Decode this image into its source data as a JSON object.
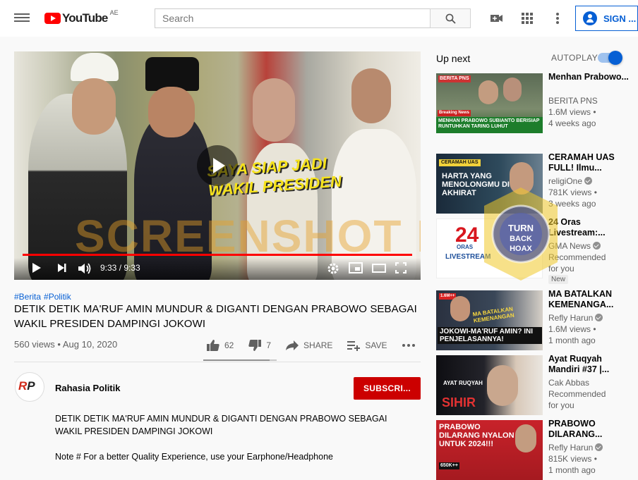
{
  "header": {
    "logo_text": "YouTube",
    "country_code": "AE",
    "search_placeholder": "Search",
    "signin_label": "SIGN ..."
  },
  "player": {
    "overlay_caption_line1": "SAYA SIAP JADI",
    "overlay_caption_line2": "WAKIL PRESIDEN",
    "watermark": "SCREENSHOT BY",
    "current_time": "9:33",
    "duration": "9:33",
    "time_display": "9:33 / 9:33",
    "progress_fraction": 1.0
  },
  "video": {
    "tags": [
      "#Berita",
      "#Politik"
    ],
    "title": "DETIK DETIK MA'RUF AMIN MUNDUR & DIGANTI DENGAN PRABOWO SEBAGAI WAKIL PRESIDEN DAMPINGI JOKOWI",
    "views_date": "560 views • Aug 10, 2020",
    "likes": "62",
    "dislikes": "7",
    "share_label": "SHARE",
    "save_label": "SAVE",
    "like_ratio": 0.9
  },
  "channel": {
    "avatar_text": "RP",
    "name": "Rahasia Politik",
    "subscribe_label": "SUBSCRI..."
  },
  "description": {
    "line1": "DETIK DETIK MA'RUF AMIN MUNDUR & DIGANTI DENGAN PRABOWO SEBAGAI WAKIL PRESIDEN DAMPINGI JOKOWI",
    "line2": "Note # For a better Quality Experience, use your Earphone/Headphone"
  },
  "sidebar": {
    "up_next": "Up next",
    "autoplay": "AUTOPLAY",
    "autoplay_on": true,
    "seal_text": "TURN BACK HOAX",
    "recommendations": [
      {
        "title": "Menhan Prabowo...",
        "channel": "BERITA PNS",
        "views": "1.6M views •",
        "age": "4 weeks ago",
        "thumb_text": "MENHAN PRABOWO SUBIANTO BERISIAP RUNTUHKAN TARING LUHUT",
        "thumb_label": "Breaking News",
        "thumb_brand": "BERITA PNS",
        "verified": false
      },
      {
        "title": "CERAMAH UAS FULL! Ilmu...",
        "channel": "religiOne",
        "views": "781K views •",
        "age": "3 weeks ago",
        "thumb_text": "HARTA YANG MENOLONGMU DI AKHIRAT",
        "thumb_label": "CERAMAH UAS",
        "verified": true
      },
      {
        "title": "24 Oras Livestream:...",
        "channel": "GMA News",
        "views": "Recommended",
        "age": "for you",
        "badge": "New",
        "thumb_text": "24",
        "thumb_label": "LIVESTREAM",
        "thumb_sub": "ORAS",
        "verified": true
      },
      {
        "title": "MA BATALKAN KEMENANGA...",
        "channel": "Refly Harun",
        "views": "1.6M views •",
        "age": "1 month ago",
        "thumb_text": "JOKOWI-MA'RUF AMIN? INI PENJELASANNYA!",
        "thumb_label": "MA BATALKAN KEMENANGAN",
        "thumb_badge": "1.6M++",
        "verified": true
      },
      {
        "title": "Ayat Ruqyah Mandiri #37 |...",
        "channel": "Cak Abbas",
        "views": "Recommended",
        "age": "for you",
        "thumb_text": "SIHIR",
        "thumb_label": "AYAT RUQYAH",
        "verified": false
      },
      {
        "title": "PRABOWO DILARANG...",
        "channel": "Refly Harun",
        "views": "815K views •",
        "age": "1 month ago",
        "thumb_text": "PRABOWO DILARANG NYALON UNTUK 2024!!!",
        "thumb_label": "650K++",
        "verified": true
      }
    ]
  }
}
